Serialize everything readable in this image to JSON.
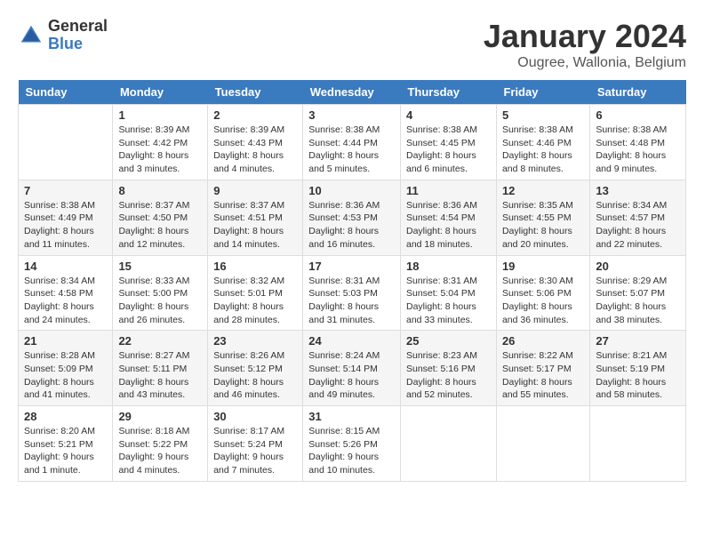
{
  "logo": {
    "general": "General",
    "blue": "Blue"
  },
  "title": "January 2024",
  "subtitle": "Ougree, Wallonia, Belgium",
  "days_of_week": [
    "Sunday",
    "Monday",
    "Tuesday",
    "Wednesday",
    "Thursday",
    "Friday",
    "Saturday"
  ],
  "weeks": [
    [
      {
        "day": "",
        "info": ""
      },
      {
        "day": "1",
        "info": "Sunrise: 8:39 AM\nSunset: 4:42 PM\nDaylight: 8 hours\nand 3 minutes."
      },
      {
        "day": "2",
        "info": "Sunrise: 8:39 AM\nSunset: 4:43 PM\nDaylight: 8 hours\nand 4 minutes."
      },
      {
        "day": "3",
        "info": "Sunrise: 8:38 AM\nSunset: 4:44 PM\nDaylight: 8 hours\nand 5 minutes."
      },
      {
        "day": "4",
        "info": "Sunrise: 8:38 AM\nSunset: 4:45 PM\nDaylight: 8 hours\nand 6 minutes."
      },
      {
        "day": "5",
        "info": "Sunrise: 8:38 AM\nSunset: 4:46 PM\nDaylight: 8 hours\nand 8 minutes."
      },
      {
        "day": "6",
        "info": "Sunrise: 8:38 AM\nSunset: 4:48 PM\nDaylight: 8 hours\nand 9 minutes."
      }
    ],
    [
      {
        "day": "7",
        "info": "Sunrise: 8:38 AM\nSunset: 4:49 PM\nDaylight: 8 hours\nand 11 minutes."
      },
      {
        "day": "8",
        "info": "Sunrise: 8:37 AM\nSunset: 4:50 PM\nDaylight: 8 hours\nand 12 minutes."
      },
      {
        "day": "9",
        "info": "Sunrise: 8:37 AM\nSunset: 4:51 PM\nDaylight: 8 hours\nand 14 minutes."
      },
      {
        "day": "10",
        "info": "Sunrise: 8:36 AM\nSunset: 4:53 PM\nDaylight: 8 hours\nand 16 minutes."
      },
      {
        "day": "11",
        "info": "Sunrise: 8:36 AM\nSunset: 4:54 PM\nDaylight: 8 hours\nand 18 minutes."
      },
      {
        "day": "12",
        "info": "Sunrise: 8:35 AM\nSunset: 4:55 PM\nDaylight: 8 hours\nand 20 minutes."
      },
      {
        "day": "13",
        "info": "Sunrise: 8:34 AM\nSunset: 4:57 PM\nDaylight: 8 hours\nand 22 minutes."
      }
    ],
    [
      {
        "day": "14",
        "info": "Sunrise: 8:34 AM\nSunset: 4:58 PM\nDaylight: 8 hours\nand 24 minutes."
      },
      {
        "day": "15",
        "info": "Sunrise: 8:33 AM\nSunset: 5:00 PM\nDaylight: 8 hours\nand 26 minutes."
      },
      {
        "day": "16",
        "info": "Sunrise: 8:32 AM\nSunset: 5:01 PM\nDaylight: 8 hours\nand 28 minutes."
      },
      {
        "day": "17",
        "info": "Sunrise: 8:31 AM\nSunset: 5:03 PM\nDaylight: 8 hours\nand 31 minutes."
      },
      {
        "day": "18",
        "info": "Sunrise: 8:31 AM\nSunset: 5:04 PM\nDaylight: 8 hours\nand 33 minutes."
      },
      {
        "day": "19",
        "info": "Sunrise: 8:30 AM\nSunset: 5:06 PM\nDaylight: 8 hours\nand 36 minutes."
      },
      {
        "day": "20",
        "info": "Sunrise: 8:29 AM\nSunset: 5:07 PM\nDaylight: 8 hours\nand 38 minutes."
      }
    ],
    [
      {
        "day": "21",
        "info": "Sunrise: 8:28 AM\nSunset: 5:09 PM\nDaylight: 8 hours\nand 41 minutes."
      },
      {
        "day": "22",
        "info": "Sunrise: 8:27 AM\nSunset: 5:11 PM\nDaylight: 8 hours\nand 43 minutes."
      },
      {
        "day": "23",
        "info": "Sunrise: 8:26 AM\nSunset: 5:12 PM\nDaylight: 8 hours\nand 46 minutes."
      },
      {
        "day": "24",
        "info": "Sunrise: 8:24 AM\nSunset: 5:14 PM\nDaylight: 8 hours\nand 49 minutes."
      },
      {
        "day": "25",
        "info": "Sunrise: 8:23 AM\nSunset: 5:16 PM\nDaylight: 8 hours\nand 52 minutes."
      },
      {
        "day": "26",
        "info": "Sunrise: 8:22 AM\nSunset: 5:17 PM\nDaylight: 8 hours\nand 55 minutes."
      },
      {
        "day": "27",
        "info": "Sunrise: 8:21 AM\nSunset: 5:19 PM\nDaylight: 8 hours\nand 58 minutes."
      }
    ],
    [
      {
        "day": "28",
        "info": "Sunrise: 8:20 AM\nSunset: 5:21 PM\nDaylight: 9 hours\nand 1 minute."
      },
      {
        "day": "29",
        "info": "Sunrise: 8:18 AM\nSunset: 5:22 PM\nDaylight: 9 hours\nand 4 minutes."
      },
      {
        "day": "30",
        "info": "Sunrise: 8:17 AM\nSunset: 5:24 PM\nDaylight: 9 hours\nand 7 minutes."
      },
      {
        "day": "31",
        "info": "Sunrise: 8:15 AM\nSunset: 5:26 PM\nDaylight: 9 hours\nand 10 minutes."
      },
      {
        "day": "",
        "info": ""
      },
      {
        "day": "",
        "info": ""
      },
      {
        "day": "",
        "info": ""
      }
    ]
  ]
}
